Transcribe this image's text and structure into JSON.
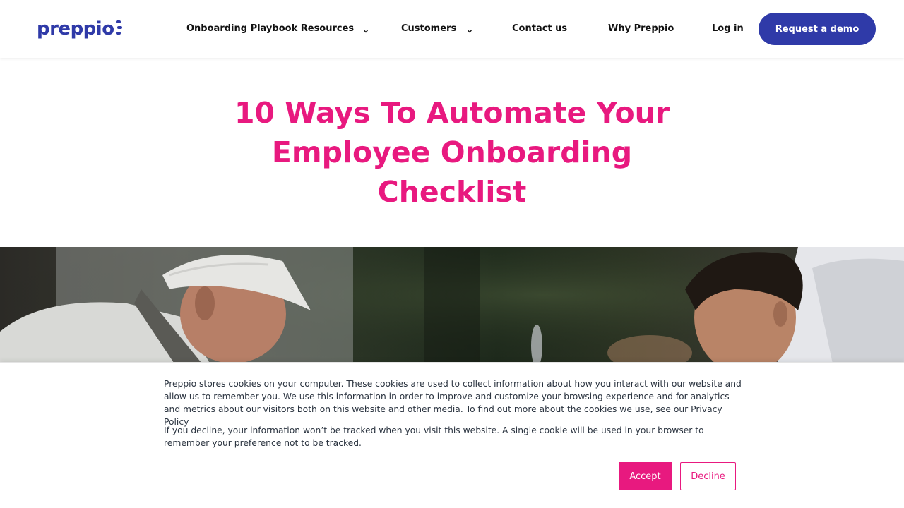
{
  "brand": {
    "name": "preppio",
    "primary_color": "#2f3aa8",
    "accent_color": "#e8197f"
  },
  "nav": {
    "items": [
      {
        "label": "Onboarding Playbook Resources",
        "has_dropdown": true
      },
      {
        "label": "Customers",
        "has_dropdown": true
      },
      {
        "label": "Contact us",
        "has_dropdown": false
      },
      {
        "label": "Why Preppio",
        "has_dropdown": false
      },
      {
        "label": "Log in",
        "has_dropdown": false
      }
    ],
    "cta_label": "Request a demo"
  },
  "article": {
    "title_lines": [
      "10 Ways To Automate Your",
      "Employee Onboarding",
      "Checklist"
    ],
    "hero_image": "photo-older-man-in-cap-and-young-man-in-white-hoodie-outdoors"
  },
  "cookie_banner": {
    "paragraph_1": "Preppio stores cookies on your computer. These cookies are used to collect information about how you interact with our website and allow us to remember you. We use this information in order to improve and customize your browsing experience and for analytics and metrics about our visitors both on this website and other media. To find out more about the cookies we use, see our Privacy Policy",
    "paragraph_2": "If you decline, your information won’t be tracked when you visit this website. A single cookie will be used in your browser to remember your preference not to be tracked.",
    "accept_label": "Accept",
    "decline_label": "Decline"
  },
  "icons": {
    "chevron": "chevron-down-icon",
    "logo_mark": "preppio-logo-mark"
  }
}
